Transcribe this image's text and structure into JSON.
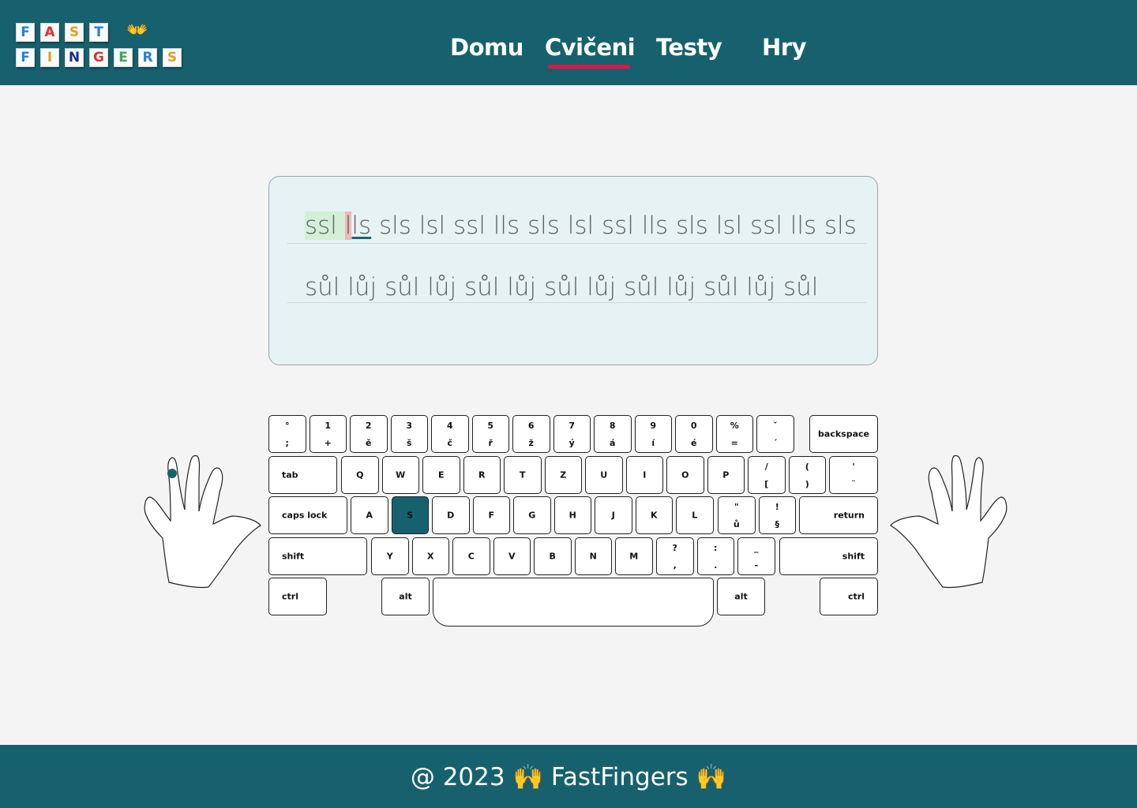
{
  "logo": {
    "row1": [
      "F",
      "A",
      "S",
      "T"
    ],
    "row2": [
      "F",
      "I",
      "N",
      "G",
      "E",
      "R",
      "S"
    ],
    "row1_colors": [
      "#2a7fd4",
      "#d9342b",
      "#e0a020",
      "#2a7fd4"
    ],
    "row2_colors": [
      "#2a7fd4",
      "#e0a020",
      "#1a2f8a",
      "#d9342b",
      "#3aa655",
      "#2a7fd4",
      "#e0a020"
    ],
    "hands": "👐"
  },
  "nav": {
    "items": [
      {
        "label": "Domu"
      },
      {
        "label": "Cvičeni"
      },
      {
        "label": "Testy"
      },
      {
        "label": "Hry"
      }
    ],
    "active": "Cvičeni",
    "accent": "#e0144c"
  },
  "exercise": {
    "line1": {
      "typed": "ssl ",
      "error": "l",
      "next": "ls",
      "rest": " sls lsl ssl lls sls lsl ssl lls sls lsl ssl lls sls"
    },
    "line2": "sůl lůj sůl lůj sůl lůj sůl lůj sůl lůj sůl lůj sůl"
  },
  "keyboard": {
    "active_key": "S",
    "active_color": "#17616e",
    "rows": {
      "number": [
        {
          "top": "°",
          "bottom": ";"
        },
        {
          "top": "1",
          "bottom": "+"
        },
        {
          "top": "2",
          "bottom": "ě"
        },
        {
          "top": "3",
          "bottom": "š"
        },
        {
          "top": "4",
          "bottom": "č"
        },
        {
          "top": "5",
          "bottom": "ř"
        },
        {
          "top": "6",
          "bottom": "ž"
        },
        {
          "top": "7",
          "bottom": "ý"
        },
        {
          "top": "8",
          "bottom": "á"
        },
        {
          "top": "9",
          "bottom": "í"
        },
        {
          "top": "0",
          "bottom": "é"
        },
        {
          "top": "%",
          "bottom": "="
        },
        {
          "top": "ˇ",
          "bottom": "´"
        }
      ],
      "backspace": "backspace",
      "tab": "tab",
      "top": [
        "Q",
        "W",
        "E",
        "R",
        "T",
        "Z",
        "U",
        "I",
        "O",
        "P"
      ],
      "top_extra": [
        {
          "top": "/",
          "bottom": "["
        },
        {
          "top": "(",
          "bottom": ")"
        },
        {
          "top": "'",
          "bottom": "¨"
        }
      ],
      "caps": "caps lock",
      "home": [
        "A",
        "S",
        "D",
        "F",
        "G",
        "H",
        "J",
        "K",
        "L"
      ],
      "home_extra": [
        {
          "top": "\"",
          "bottom": "ů"
        },
        {
          "top": "!",
          "bottom": "§"
        }
      ],
      "return": "return",
      "shift": "shift",
      "bottom": [
        "Y",
        "X",
        "C",
        "V",
        "B",
        "N",
        "M"
      ],
      "bottom_extra": [
        {
          "top": "?",
          "bottom": ","
        },
        {
          "top": ":",
          "bottom": "."
        },
        {
          "top": "_",
          "bottom": "-"
        }
      ],
      "ctrl": "ctrl",
      "alt": "alt"
    }
  },
  "footer": {
    "text": "@ 2023 🙌 FastFingers 🙌"
  }
}
